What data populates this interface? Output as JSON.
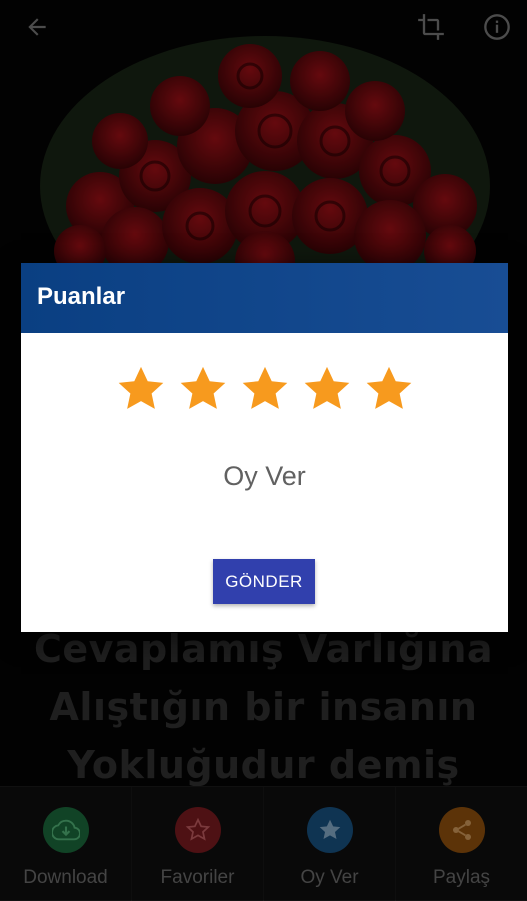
{
  "background": {
    "quote_lines": [
      "Cevaplamış  Varlığına",
      "Alıştığın bir insanın",
      "Yokluğudur demiş"
    ]
  },
  "topbar": {
    "back_icon": "arrow-left-icon",
    "crop_icon": "crop-icon",
    "info_icon": "info-icon"
  },
  "dialog": {
    "title": "Puanlar",
    "rating": {
      "value": 5,
      "max": 5
    },
    "vote_text": "Oy Ver",
    "submit_label": "GÖNDER",
    "header_color": "#0a3f82",
    "star_color": "#f79a1e",
    "button_color": "#3140ad"
  },
  "bottom_nav": {
    "items": [
      {
        "label": "Download",
        "icon": "cloud-download-icon",
        "color": "#1f7a45"
      },
      {
        "label": "Favoriler",
        "icon": "star-outline-icon",
        "color": "#8e1f25"
      },
      {
        "label": "Oy Ver",
        "icon": "star-icon",
        "color": "#1c5f96"
      },
      {
        "label": "Paylaş",
        "icon": "share-icon",
        "color": "#a85e10"
      }
    ]
  }
}
